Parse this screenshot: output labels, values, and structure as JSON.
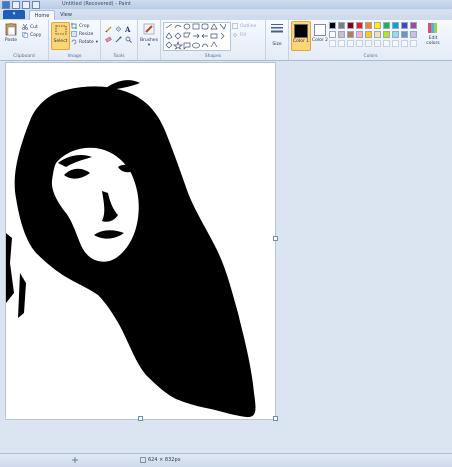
{
  "window": {
    "title": "Untitled (Recovered) - Paint"
  },
  "tabs": {
    "file": "▾",
    "home": "Home",
    "view": "View"
  },
  "clipboard": {
    "paste": "Paste",
    "cut": "Cut",
    "copy": "Copy",
    "group": "Clipboard"
  },
  "image": {
    "select": "Select",
    "crop": "Crop",
    "resize": "Resize",
    "rotate": "Rotate",
    "group": "Image"
  },
  "tools": {
    "group": "Tools"
  },
  "brushes": {
    "label": "Brushes"
  },
  "shapes": {
    "outline": "Outline",
    "fill": "Fill",
    "group": "Shapes"
  },
  "size": {
    "label": "Size"
  },
  "colors": {
    "color1": "Color 1",
    "color2": "Color 2",
    "edit": "Edit colors",
    "group": "Colors",
    "palette_row1": [
      "#000000",
      "#7f7f7f",
      "#880015",
      "#ed1c24",
      "#ff7f27",
      "#fff200",
      "#22b14c",
      "#00a2e8",
      "#3f48cc",
      "#a349a4"
    ],
    "palette_row2": [
      "#ffffff",
      "#c3c3c3",
      "#b97a57",
      "#ffaec9",
      "#ffc90e",
      "#efe4b0",
      "#b5e61d",
      "#99d9ea",
      "#7092be",
      "#c8bfe7"
    ]
  },
  "status": {
    "size": "624 × 832px"
  }
}
